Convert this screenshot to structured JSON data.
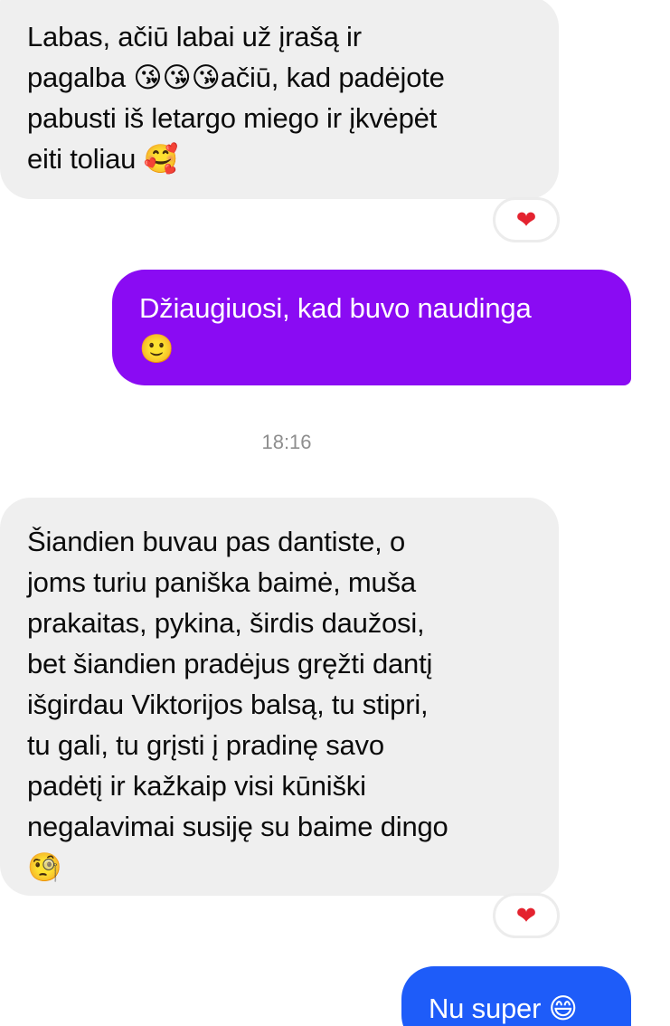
{
  "messages": [
    {
      "direction": "incoming",
      "text": "Labas, ačiū labai už įrašą ir\npagalba 😘😘😘ačiū, kad padėjote\npabusti iš letargo miego ir įkvėpėt\neiti toliau 🥰",
      "reaction": "❤"
    },
    {
      "direction": "outgoing",
      "text": "Džiaugiuosi, kad buvo naudinga\n🙂"
    },
    {
      "direction": "incoming",
      "text": "Šiandien buvau pas dantiste, o\njoms turiu paniška baimė, muša\nprakaitas, pykina, širdis daužosi,\nbet šiandien pradėjus gręžti dantį\nišgirdau Viktorijos balsą, tu stipri,\ntu gali, tu grįsti į pradinę savo\npadėtį ir kažkaip visi kūniški\nnegalavimai susiję su baime dingo\n🧐",
      "reaction": "❤"
    },
    {
      "direction": "outgoing",
      "text": "Nu super 😄"
    }
  ],
  "timestamp": "18:16",
  "colors": {
    "incoming_bubble": "#efefef",
    "outgoing_purple": "#8a0bf3",
    "outgoing_blue": "#1e5cf9",
    "reaction_heart": "#e4232f",
    "timestamp_text": "#8e8e8e"
  }
}
